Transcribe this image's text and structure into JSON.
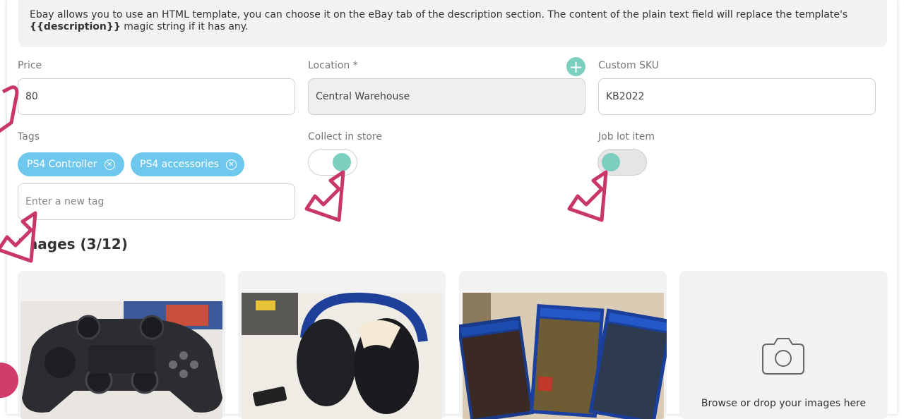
{
  "info": {
    "text_before": "Ebay allows you to use an HTML template, you can choose it on the eBay tab of the description section. The content of the plain text field will replace the template's",
    "magic": "{{description}}",
    "text_after": " magic string if it has any."
  },
  "fields": {
    "price_label": "Price",
    "price_value": "80",
    "location_label": "Location *",
    "location_value": "Central Warehouse",
    "sku_label": "Custom SKU",
    "sku_value": "KB2022",
    "tags_label": "Tags",
    "collect_label": "Collect in store",
    "joblot_label": "Job lot item"
  },
  "tags": [
    {
      "label": "PS4 Controller"
    },
    {
      "label": "PS4 accessories"
    }
  ],
  "tag_input": {
    "placeholder": "Enter a new tag"
  },
  "toggles": {
    "collect_in_store": true,
    "job_lot_item": false
  },
  "images": {
    "title": "Images (3/12)",
    "dropzone_label": "Browse or drop your images here"
  },
  "colors": {
    "accent": "#7ccfbf",
    "tag": "#6ec8ee",
    "cursor": "#c9376a"
  }
}
